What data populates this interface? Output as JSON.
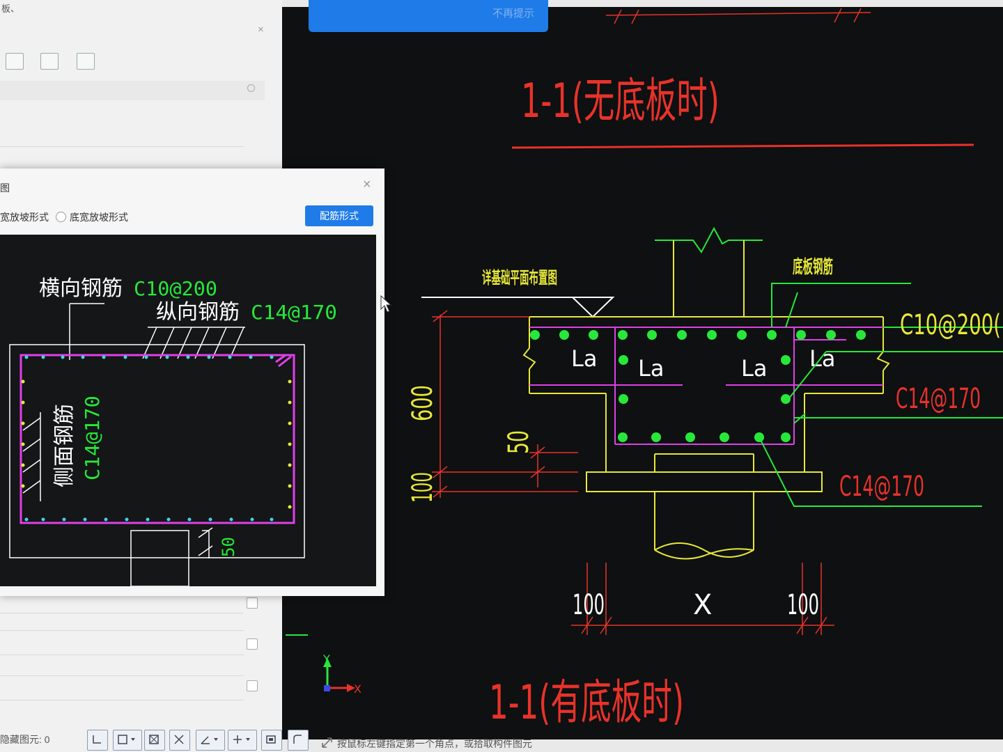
{
  "left_panel": {
    "top_title": "板、",
    "close_symbol": "×"
  },
  "notice": {
    "text": "不再提示"
  },
  "cad": {
    "title_top": "1-1(无底板时)",
    "title_bottom": "1-1(有底板时)",
    "label_foundation_ref": "详基础平面布置图",
    "label_bottom_rebar": "底板钢筋",
    "label_c10": "C10@200(",
    "label_c14_a": "C14@170",
    "label_c14_b": "C14@170",
    "dim_600": "600",
    "dim_50": "50",
    "dim_100": "100",
    "dim_100_left": "100",
    "dim_x": "X",
    "dim_100_right": "100",
    "la_1": "La",
    "la_2": "La",
    "la_3": "La",
    "la_4": "La",
    "axis_y": "Y",
    "axis_x": "X"
  },
  "dialog": {
    "title": "图",
    "close_symbol": "×",
    "option_1": "宽放坡形式",
    "option_2": "底宽放坡形式",
    "button": "配筋形式",
    "canvas": {
      "label_horizontal": "横向钢筋",
      "value_horizontal": "C10@200",
      "label_longitudinal": "纵向钢筋",
      "value_longitudinal": "C14@170",
      "label_side": "侧面钢筋",
      "value_side": "C14@170",
      "dim_50": "50"
    }
  },
  "status": {
    "left": "隐藏图元: 0",
    "prompt": "按鼠标左键指定第一个角点，或拾取构件图元"
  },
  "colors": {
    "cad_bg": "#0e1011",
    "red": "#e8322a",
    "green": "#27e83a",
    "yellow": "#e8e83a",
    "magenta": "#e040e8",
    "cyan": "#3ad8e8",
    "accent_blue": "#1f7be8"
  }
}
